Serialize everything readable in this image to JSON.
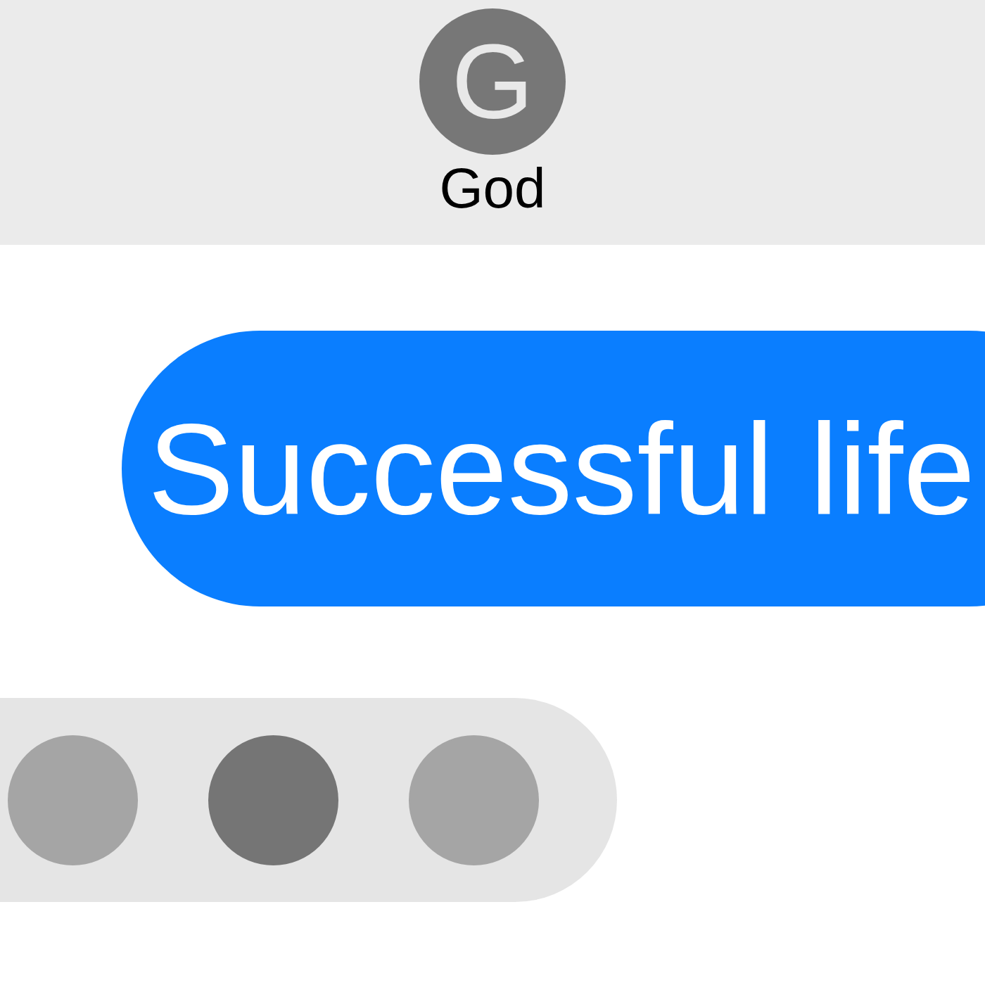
{
  "header": {
    "avatar_initial": "G",
    "name": "God"
  },
  "messages": [
    {
      "kind": "sent",
      "text": "Successful life"
    }
  ],
  "typing_indicator": {
    "dots": [
      {
        "active": false
      },
      {
        "active": true
      },
      {
        "active": false
      }
    ]
  }
}
